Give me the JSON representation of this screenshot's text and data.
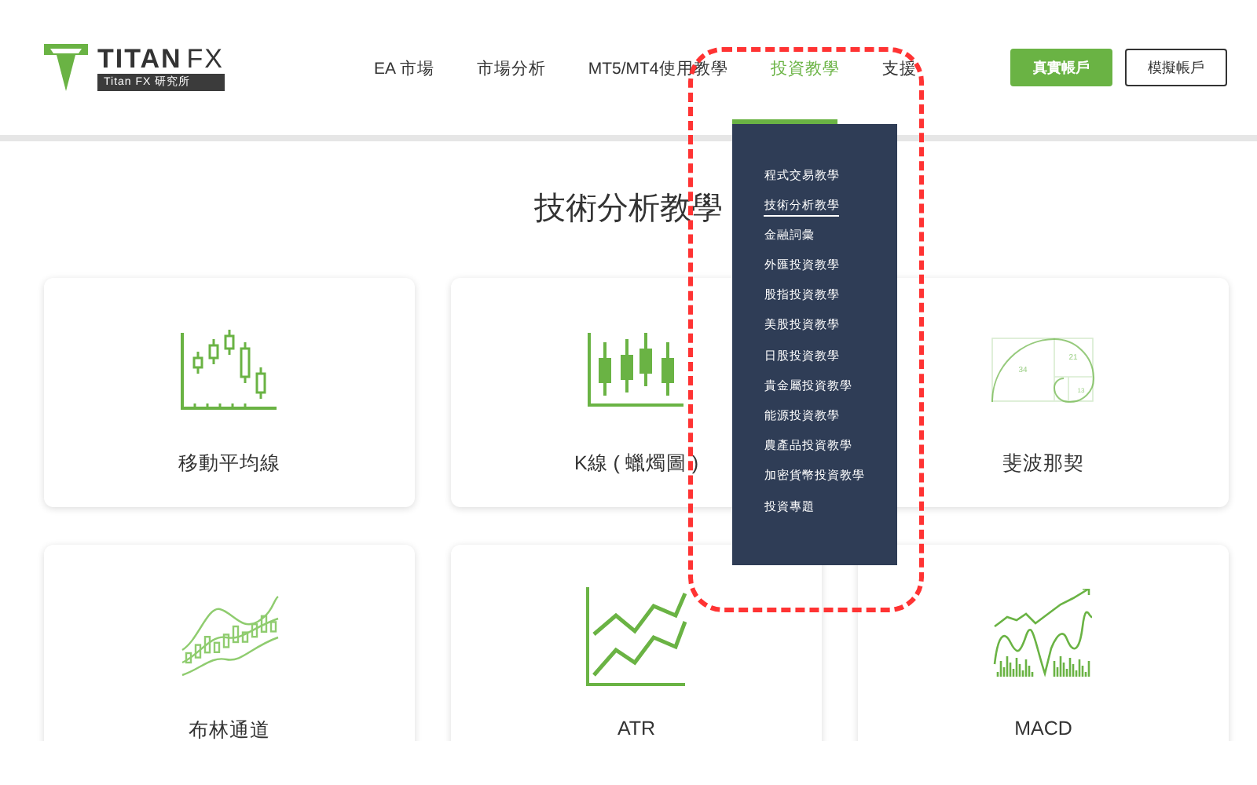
{
  "logo": {
    "brand": "TITAN",
    "brand_suffix": "FX",
    "subtitle": "Titan FX 研究所"
  },
  "nav": [
    {
      "label": "EA 市場",
      "selected": false
    },
    {
      "label": "市場分析",
      "selected": false
    },
    {
      "label": "MT5/MT4使用教學",
      "selected": false
    },
    {
      "label": "投資教學",
      "selected": true
    },
    {
      "label": "支援",
      "selected": false
    }
  ],
  "buttons": [
    {
      "label": "真實帳戶",
      "kind": "primary"
    },
    {
      "label": "模擬帳戶",
      "kind": "outline"
    }
  ],
  "dropdown": {
    "items": [
      {
        "label": "程式交易教學",
        "selected": false
      },
      {
        "label": "技術分析教學",
        "selected": true
      },
      {
        "label": "金融詞彙",
        "selected": false
      },
      {
        "label": "外匯投資教學",
        "selected": false
      },
      {
        "label": "股指投資教學",
        "selected": false
      },
      {
        "label": "美股投資教學",
        "selected": false
      },
      {
        "label": "日股投資教學",
        "selected": false
      },
      {
        "label": "貴金屬投資教學",
        "selected": false
      },
      {
        "label": "能源投資教學",
        "selected": false
      },
      {
        "label": "農產品投資教學",
        "selected": false
      },
      {
        "label": "加密貨幣投資教學",
        "selected": false
      },
      {
        "label": "投資專題",
        "selected": false
      }
    ]
  },
  "page_title": "技術分析教學",
  "cards": [
    {
      "title": "移動平均線",
      "kind": "candles"
    },
    {
      "title": "K線 ( 蠟燭圖 )",
      "kind": "candlestick"
    },
    {
      "title": "斐波那契",
      "kind": "fibonacci",
      "icon_labels": [
        "34",
        "21",
        "13"
      ]
    },
    {
      "title": "布林通道",
      "kind": "bollinger"
    },
    {
      "title": "ATR",
      "kind": "atr"
    },
    {
      "title": "MACD",
      "kind": "macd"
    }
  ]
}
